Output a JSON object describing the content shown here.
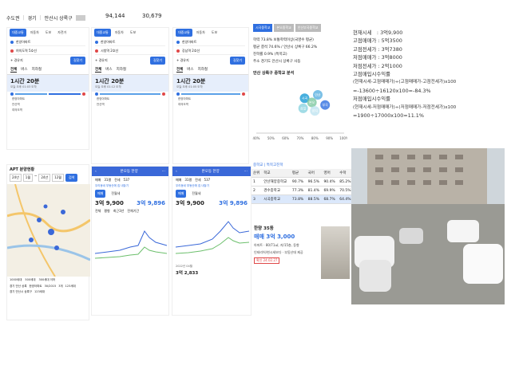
{
  "topbar": {
    "crumbs": [
      "수도권",
      "경기",
      "안산시 상록구"
    ],
    "stat1": "94,144",
    "stat2": "30,679"
  },
  "route": {
    "tabs": [
      "대중교통",
      "자동차",
      "도보",
      "자전거"
    ],
    "origin": "한양아파트",
    "dest1": "여의도역 5호선",
    "dest2": "시청역 2호선",
    "dest3": "강남역 2호선",
    "add": "+ 경유지",
    "search": "길찾기",
    "filters": [
      "전체",
      "버스",
      "지하철",
      "버스+지하철"
    ],
    "p1": {
      "time": "1시간 20분",
      "note": "오늘 오후 01:03 도착",
      "fare": "2,350원"
    },
    "p2": {
      "time": "1시간 20분",
      "note": "오늘 오후 01:12 도착",
      "fare": "2,550원"
    },
    "p3": {
      "time": "1시간 20분",
      "note": "오늘 오후 01:05 도착",
      "fare": "2,600원"
    },
    "stops": [
      "한양아파트",
      "안산역",
      "여의도역"
    ]
  },
  "apt": {
    "title": "APT 분양현황",
    "filters": [
      "24년",
      "1월",
      "~",
      "24년",
      "12월",
      "검색"
    ],
    "legend": [
      "1000세대",
      "500세대",
      "300세대 이하"
    ],
    "rows": [
      [
        "경기 안산 상록",
        "한양아파트",
        "30/2015",
        "3개",
        "123세대"
      ],
      [
        "경기 안산시 상록구",
        "",
        "",
        "",
        "123세대"
      ]
    ]
  },
  "mobile": {
    "header": "본오동 한양",
    "tabs": [
      "매매",
      "31평",
      "전세",
      "537"
    ],
    "banner": "우리동네 부동산에 집 내놓기",
    "sub_tabs": [
      "매매",
      "전월세"
    ],
    "price_left": "3억 9,900",
    "price_right": "3억 9,896",
    "date": "2022년 04월",
    "bottom_price": "3억 2,833",
    "view_tabs": [
      "전체",
      "평형",
      "최근3년",
      "전체기간"
    ]
  },
  "school": {
    "tabs": [
      "시곡중학교",
      "본오중학교",
      "안산부곡중학교"
    ],
    "lines": [
      "학력 73.8% 보통학력이상(국영수 평균)",
      "평균 결석 74.6% / 안산시 상록구 66.2%",
      "진학률 0.9% (특목고)",
      "주소 경기도 안산시 상록구 사동"
    ],
    "chart_title": "안산 상록구 중학교 분석",
    "chart_data": {
      "type": "scatter",
      "xlabel": "",
      "ylabel": "",
      "xlim": [
        40,
        100
      ],
      "x_ticks": [
        "40%",
        "50%",
        "60%",
        "70%",
        "80%",
        "90%",
        "100%"
      ],
      "points": [
        {
          "label": "시곡",
          "x": 73,
          "y": 60,
          "color": "#1a9bd6"
        },
        {
          "label": "본오",
          "x": 78,
          "y": 55,
          "color": "#7ec8a0"
        },
        {
          "label": "안산",
          "x": 82,
          "y": 64,
          "color": "#5ab0e0"
        },
        {
          "label": "부곡",
          "x": 87,
          "y": 52,
          "color": "#2f6fe0"
        },
        {
          "label": "삼일",
          "x": 72,
          "y": 48,
          "color": "#8bd3e0"
        },
        {
          "label": "양지",
          "x": 80,
          "y": 45,
          "color": "#bfe3f0"
        }
      ]
    },
    "table_header": "중학교 | 특목고진학",
    "columns": [
      "순위",
      "학교",
      "평균",
      "국어",
      "영어",
      "수학"
    ],
    "rows": [
      [
        "1",
        "안산해양중학교",
        "90.7%",
        "96.5%",
        "90.4%",
        "85.2%"
      ],
      [
        "2",
        "경수중학교",
        "77.3%",
        "81.4%",
        "69.9%",
        "70.5%"
      ],
      [
        "3",
        "시곡중학교",
        "73.8%",
        "88.5%",
        "68.7%",
        "64.4%"
      ]
    ]
  },
  "listing": {
    "title": "한양 35동",
    "price": "매매 3억 3,000",
    "spec": "아파트 · 80/71㎡, 저/15층, 동향",
    "desc": "인테리어/현시세보다 · 부동산데 제공",
    "date": "확인 24.02.27"
  },
  "calc": [
    "현재시세　: 3억9,900",
    "고점매매가 : 5억3500",
    "고점전세가 : 3억7380",
    "저점매매가 : 3억8000",
    "저점전세가 : 2억1000",
    "고점매입시수익률",
    "(현재시세-고점매매가)÷(고점매매가-고점전세가)x100",
    "=-13600÷16120x100=-84.3%",
    "저점매입시수익률",
    "(현재시세-저점매매가)÷(저점매매가-저점전세가)x100",
    "=1900÷17000x100=11.1%"
  ],
  "colors": {
    "accent": "#2f6fe0",
    "header": "#3a68d8"
  }
}
